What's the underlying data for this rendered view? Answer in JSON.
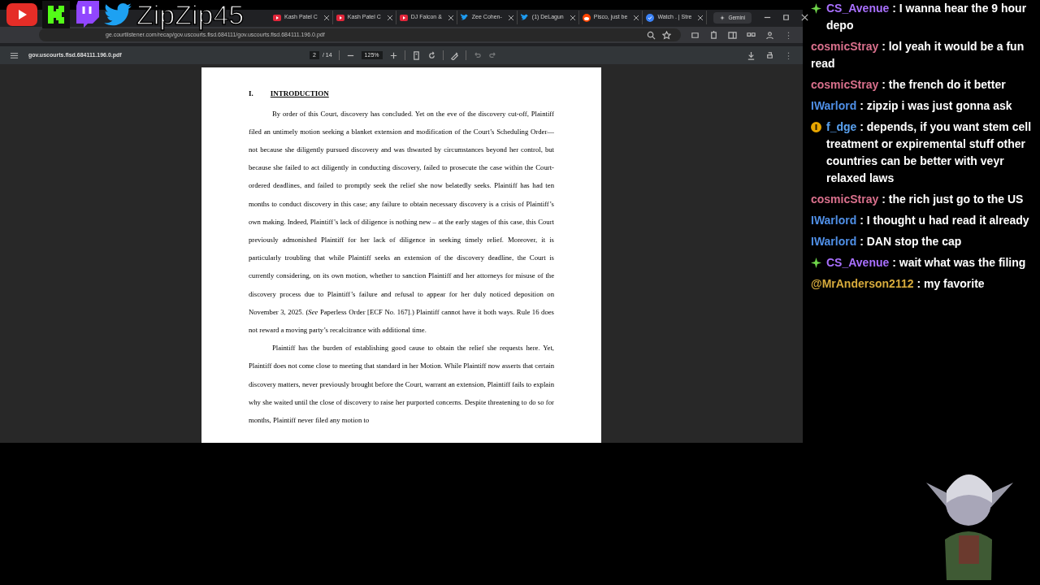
{
  "overlay": {
    "channel_name": "ZipZip45"
  },
  "browser": {
    "tabs": [
      {
        "title": "Kash Patel C",
        "kind": "video",
        "selected": false
      },
      {
        "title": "Kash Patel C",
        "kind": "video",
        "selected": false
      },
      {
        "title": "DJ Falcon &",
        "kind": "video",
        "selected": false
      },
      {
        "title": "Zee Cohen-",
        "kind": "bird",
        "selected": false
      },
      {
        "title": "(1) DeLagun",
        "kind": "bird",
        "selected": false
      },
      {
        "title": "Pisco, just be",
        "kind": "alien",
        "selected": false
      },
      {
        "title": "Watch . | Stre",
        "kind": "check",
        "selected": false
      }
    ],
    "gemini_button": "Gemini",
    "address": "ge.courtlistener.com/recap/gov.uscourts.flsd.684111/gov.uscourts.flsd.684111.196.0.pdf"
  },
  "pdf_viewer": {
    "file_name": "gov.uscourts.flsd.684111.196.0.pdf",
    "page": "2",
    "page_total": "/ 14",
    "zoom": "125%",
    "document": {
      "section_number": "I.",
      "section_title": "INTRODUCTION",
      "paragraphs": [
        "By order of this Court, discovery has concluded. Yet on the eve of the discovery cut-off, Plaintiff filed an untimely motion seeking a blanket extension and modification of the Court’s Scheduling Order—not because she diligently pursued discovery and was thwarted by circumstances beyond her control, but because she failed to act diligently in conducting discovery, failed to prosecute the case within the Court-ordered deadlines, and failed to promptly seek the relief she now belatedly seeks. Plaintiff has had ten months to conduct discovery in this case; any failure to obtain necessary discovery is a crisis of Plaintiff’s own making. Indeed, Plaintiff’s lack of diligence is nothing new – at the early stages of this case, this Court previously admonished Plaintiff for her lack of diligence in seeking timely relief. Moreover, it is particularly troubling that while Plaintiff seeks an extension of the discovery deadline, the Court is currently considering, on its own motion, whether to sanction Plaintiff and her attorneys for misuse of the discovery process due to Plaintiff’s failure and refusal to appear for her duly noticed deposition on November 3, 2025. (*See* Paperless Order [ECF No. 167].) Plaintiff cannot have it both ways. Rule 16 does not reward a moving party’s recalcitrance with additional time.",
        "Plaintiff has the burden of establishing good cause to obtain the relief she requests here. Yet, Plaintiff does not come close to meeting that standard in her Motion. While Plaintiff now asserts that certain discovery matters, never previously brought before the Court, warrant an extension, Plaintiff fails to explain why she waited until the close of discovery to raise her purported concerns. Despite threatening to do so for months, Plaintiff never filed any motion to"
      ]
    }
  },
  "chat": {
    "messages": [
      {
        "user": "CS_Avenue",
        "color": "#a970ff",
        "kind": "diamond",
        "text": ": I wanna hear the 9 hour depo"
      },
      {
        "user": "cosmicStray",
        "color": "#d9708c",
        "kind": "plain",
        "text": ": lol yeah it would be a fun read"
      },
      {
        "user": "cosmicStray",
        "color": "#d9708c",
        "kind": "plain",
        "text": ": the french do it better"
      },
      {
        "user": "IWarlord",
        "color": "#4f8fe6",
        "kind": "plain",
        "text": ": zipzip i was just gonna ask"
      },
      {
        "user": "f_dge",
        "color": "#5aa2f0",
        "kind": "coin",
        "text": ": depends, if you want stem cell treatment or expiremental stuff other countries can be better with veyr relaxed laws"
      },
      {
        "user": "cosmicStray",
        "color": "#d9708c",
        "kind": "plain",
        "text": ": the rich just go to the US"
      },
      {
        "user": "IWarlord",
        "color": "#4f8fe6",
        "kind": "plain",
        "text": ": I thought u had read it already"
      },
      {
        "user": "IWarlord",
        "color": "#4f8fe6",
        "kind": "plain",
        "text": ": DAN stop the cap"
      },
      {
        "user": "CS_Avenue",
        "color": "#a970ff",
        "kind": "diamond",
        "text": ": wait what was the filing"
      },
      {
        "user": "@MrAnderson2112",
        "color": "#d6aa3c",
        "kind": "plain",
        "text": ": my favorite"
      }
    ]
  }
}
